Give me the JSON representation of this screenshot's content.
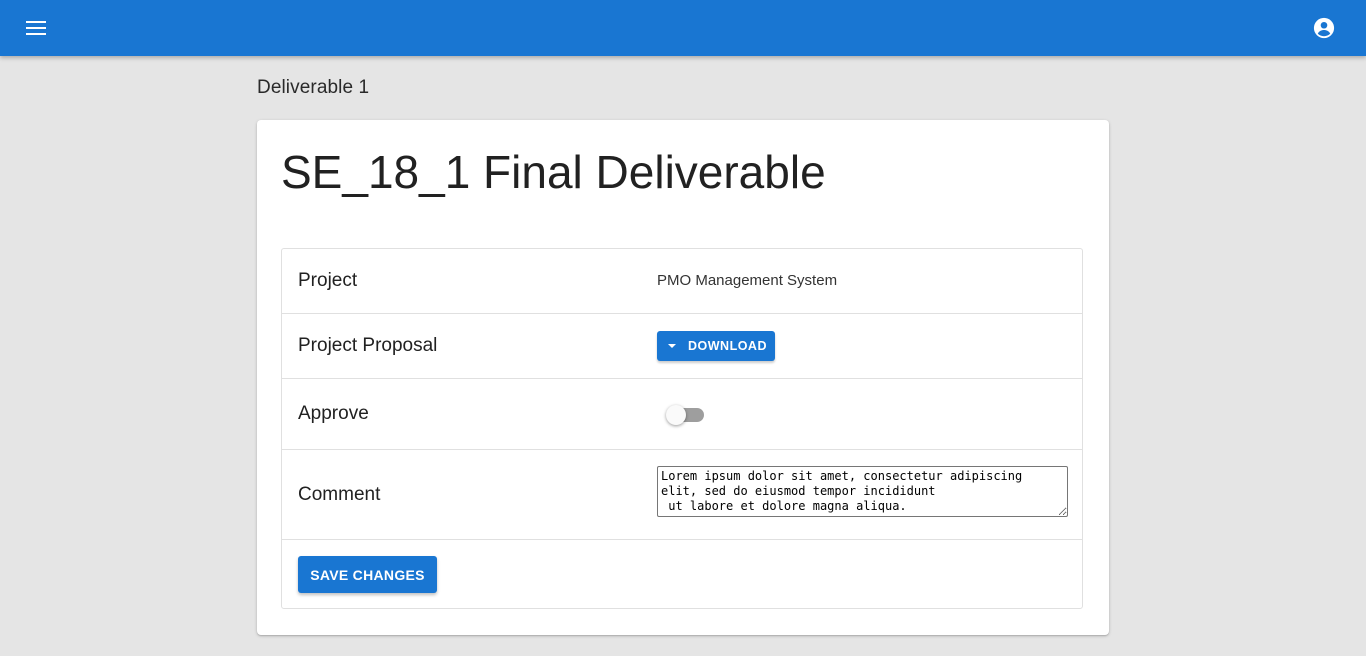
{
  "appbar": {
    "menu_icon": "menu-icon",
    "account_icon": "account-circle-icon",
    "color": "#1976d2"
  },
  "page": {
    "heading": "Deliverable 1"
  },
  "card": {
    "title": "SE_18_1 Final Deliverable",
    "rows": {
      "project": {
        "label": "Project",
        "value": "PMO Management System"
      },
      "proposal": {
        "label": "Project Proposal",
        "button_label": "DOWNLOAD",
        "button_icon": "arrow-drop-down-icon"
      },
      "approve": {
        "label": "Approve",
        "checked": false
      },
      "comment": {
        "label": "Comment",
        "value": "Lorem ipsum dolor sit amet, consectetur adipiscing elit, sed do eiusmod tempor incididunt\n ut labore et dolore magna aliqua."
      }
    },
    "save_label": "SAVE CHANGES"
  }
}
